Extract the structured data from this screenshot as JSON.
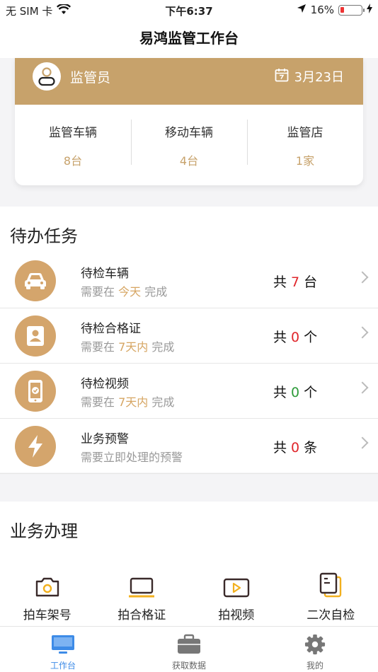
{
  "status": {
    "carrier": "无 SIM 卡",
    "time": "下午6:37",
    "battery": "16%",
    "battery_level": 0.16
  },
  "nav": {
    "title": "易鸿监管工作台"
  },
  "summary": {
    "role": "监管员",
    "date": "3月23日",
    "stats": [
      {
        "label": "监管车辆",
        "value": "8台"
      },
      {
        "label": "移动车辆",
        "value": "4台"
      },
      {
        "label": "监管店",
        "value": "1家"
      }
    ]
  },
  "todo": {
    "title": "待办任务",
    "items": [
      {
        "title": "待检车辆",
        "desc_pre": "需要在 ",
        "desc_hl": "今天",
        "desc_post": " 完成",
        "count_pre": "共 ",
        "count": "7",
        "count_post": " 台",
        "icon": "car-icon"
      },
      {
        "title": "待检合格证",
        "desc_pre": "需要在 ",
        "desc_hl": "7天内",
        "desc_post": " 完成",
        "count_pre": "共 ",
        "count": "0",
        "count_post": " 个",
        "icon": "certificate-icon"
      },
      {
        "title": "待检视频",
        "desc_pre": "需要在 ",
        "desc_hl": "7天内",
        "desc_post": " 完成",
        "count_pre": "共 ",
        "count": "0",
        "count_post": " 个",
        "icon": "phone-video-icon"
      },
      {
        "title": "业务预警",
        "desc_full": "需要立即处理的预警",
        "count_pre": "共 ",
        "count": "0",
        "count_post": " 条",
        "icon": "lightning-icon"
      }
    ]
  },
  "business": {
    "title": "业务办理",
    "items": [
      {
        "label": "拍车架号",
        "icon": "camera-icon"
      },
      {
        "label": "拍合格证",
        "icon": "laptop-icon"
      },
      {
        "label": "拍视频",
        "icon": "video-play-icon"
      },
      {
        "label": "二次自检",
        "icon": "documents-icon"
      }
    ]
  },
  "tabs": [
    {
      "label": "工作台",
      "icon": "monitor-icon",
      "active": true
    },
    {
      "label": "获取数据",
      "icon": "briefcase-icon",
      "active": false
    },
    {
      "label": "我的",
      "icon": "gear-icon",
      "active": false
    }
  ],
  "colors": {
    "accent": "#c7a26b",
    "red": "#e0262b",
    "green": "#2e9b3a",
    "tab_active": "#3d8be7"
  }
}
